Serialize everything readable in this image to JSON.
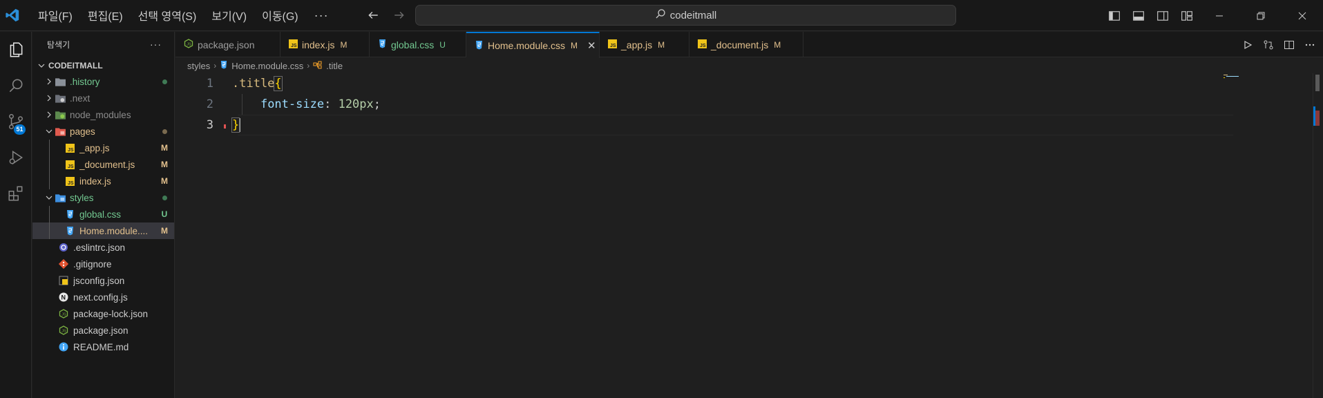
{
  "menu": {
    "items": [
      "파일(F)",
      "편집(E)",
      "선택 영역(S)",
      "보기(V)",
      "이동(G)"
    ],
    "more": "···"
  },
  "search": {
    "text": "codeitmall"
  },
  "activity": {
    "source_control_badge": "51"
  },
  "explorer": {
    "title": "탐색기",
    "more": "···",
    "project": "CODEITMALL",
    "rows": [
      {
        "label": ".history",
        "status": "",
        "color": "#73c991",
        "dot": "#3f7a55"
      },
      {
        "label": ".next",
        "status": "",
        "color": "#8c8c8c",
        "dot": ""
      },
      {
        "label": "node_modules",
        "status": "",
        "color": "#8c8c8c",
        "dot": ""
      },
      {
        "label": "pages",
        "status": "",
        "color": "#e2c08d",
        "dot": "#7a6a4f"
      },
      {
        "label": "_app.js",
        "status": "M",
        "color": "#e2c08d"
      },
      {
        "label": "_document.js",
        "status": "M",
        "color": "#e2c08d"
      },
      {
        "label": "index.js",
        "status": "M",
        "color": "#e2c08d"
      },
      {
        "label": "styles",
        "status": "",
        "color": "#73c991",
        "dot": "#3f7a55"
      },
      {
        "label": "global.css",
        "status": "U",
        "color": "#73c991"
      },
      {
        "label": "Home.module....",
        "status": "M",
        "color": "#e2c08d"
      },
      {
        "label": ".eslintrc.json",
        "status": "",
        "color": "#cccccc"
      },
      {
        "label": ".gitignore",
        "status": "",
        "color": "#cccccc"
      },
      {
        "label": "jsconfig.json",
        "status": "",
        "color": "#cccccc"
      },
      {
        "label": "next.config.js",
        "status": "",
        "color": "#cccccc"
      },
      {
        "label": "package-lock.json",
        "status": "",
        "color": "#cccccc"
      },
      {
        "label": "package.json",
        "status": "",
        "color": "#cccccc"
      },
      {
        "label": "README.md",
        "status": "",
        "color": "#cccccc"
      }
    ]
  },
  "tabs": [
    {
      "label": "package.json",
      "status": "",
      "color": "#9d9d9d"
    },
    {
      "label": "index.js",
      "status": "M",
      "color": "#e2c08d"
    },
    {
      "label": "global.css",
      "status": "U",
      "color": "#73c991"
    },
    {
      "label": "Home.module.css",
      "status": "M",
      "color": "#e2c08d",
      "close": "✕"
    },
    {
      "label": "_app.js",
      "status": "M",
      "color": "#e2c08d"
    },
    {
      "label": "_document.js",
      "status": "M",
      "color": "#e2c08d"
    }
  ],
  "breadcrumbs": {
    "folder": "styles",
    "file": "Home.module.css",
    "symbol": ".title"
  },
  "code": {
    "line_numbers": [
      "1",
      "2",
      "3"
    ],
    "line1": {
      "selector": ".title",
      "brace": "{"
    },
    "line2": {
      "prop": "font-size",
      "colon": ":",
      "value": "120px",
      "semi": ";"
    },
    "line3": {
      "brace": "}"
    }
  },
  "colors": {
    "accent": "#0078d4",
    "modified": "#e2c08d",
    "untracked": "#73c991",
    "background": "#1f1f1f"
  }
}
